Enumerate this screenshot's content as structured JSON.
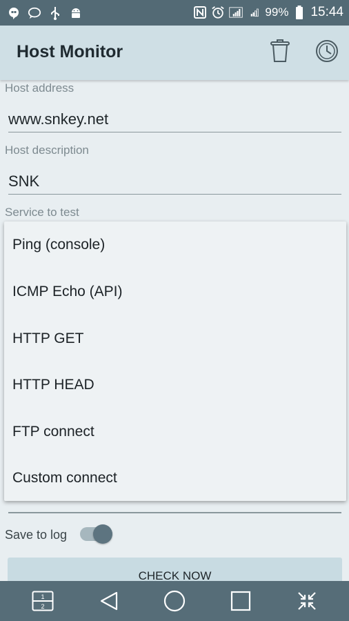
{
  "status_bar": {
    "icons_left": [
      "hangouts-icon",
      "chat-bubble-icon",
      "usb-icon",
      "android-icon"
    ],
    "icons_right": [
      "nfc-icon",
      "alarm-icon",
      "signal-1-icon",
      "signal-2-icon",
      "battery-icon"
    ],
    "battery": "99%",
    "time": "15:44"
  },
  "app_bar": {
    "title": "Host Monitor",
    "actions": [
      "trash-icon",
      "history-icon"
    ]
  },
  "form": {
    "host_address": {
      "label": "Host address",
      "value": "www.snkey.net"
    },
    "host_description": {
      "label": "Host description",
      "value": "SNK"
    },
    "service": {
      "label": "Service to test"
    }
  },
  "service_dropdown": {
    "options": [
      "Ping (console)",
      "ICMP Echo (API)",
      "HTTP GET",
      "HTTP HEAD",
      "FTP connect",
      "Custom connect"
    ]
  },
  "save_to_log": {
    "label": "Save to log",
    "enabled": true
  },
  "check_button": {
    "label": "CHECK NOW"
  },
  "nav_bar": {
    "icons": [
      "dual-window-icon",
      "back-icon",
      "home-icon",
      "recents-icon",
      "collapse-icon"
    ]
  },
  "colors": {
    "status_bar": "#536a75",
    "app_bar": "#cfdfe5",
    "background": "#e8eef1",
    "nav_bar": "#566d78",
    "accent": "#5d7480"
  }
}
